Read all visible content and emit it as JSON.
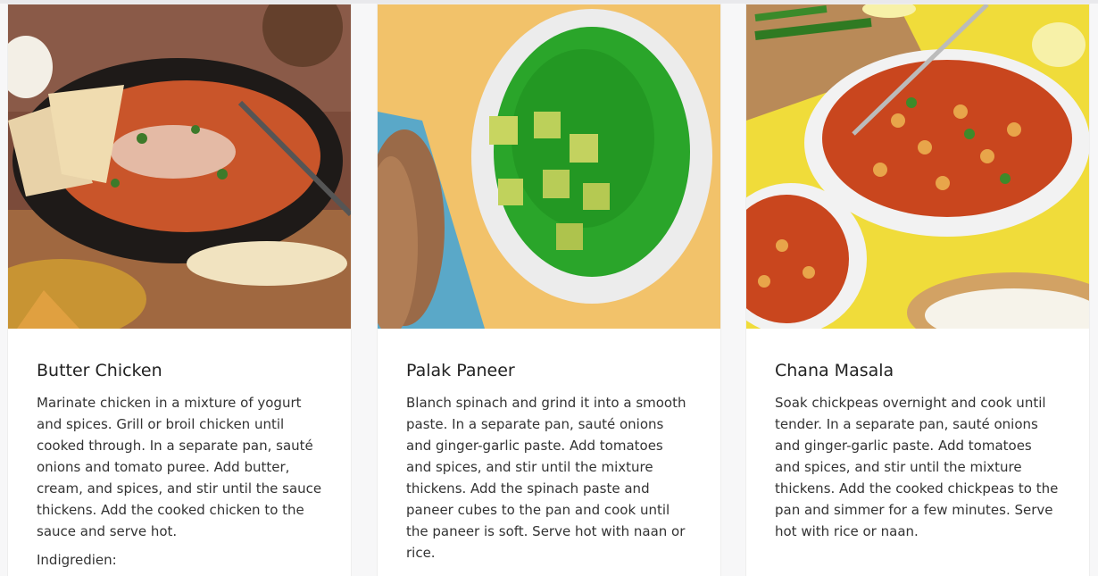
{
  "recipes": [
    {
      "title": "Butter Chicken",
      "description": "Marinate chicken in a mixture of yogurt and spices. Grill or broil chicken until cooked through. In a separate pan, sauté onions and tomato puree. Add butter, cream, and spices, and stir until the sauce thickens. Add the cooked chicken to the sauce and serve hot.",
      "ingredients_label": "Indigredien:"
    },
    {
      "title": "Palak Paneer",
      "description": "Blanch spinach and grind it into a smooth paste. In a separate pan, sauté onions and ginger-garlic paste. Add tomatoes and spices, and stir until the mixture thickens. Add the spinach paste and paneer cubes to the pan and cook until the paneer is soft. Serve hot with naan or rice."
    },
    {
      "title": "Chana Masala",
      "description": "Soak chickpeas overnight and cook until tender. In a separate pan, sauté onions and ginger-garlic paste. Add tomatoes and spices, and stir until the mixture thickens. Add the cooked chickpeas to the pan and simmer for a few minutes. Serve hot with rice or naan."
    }
  ]
}
